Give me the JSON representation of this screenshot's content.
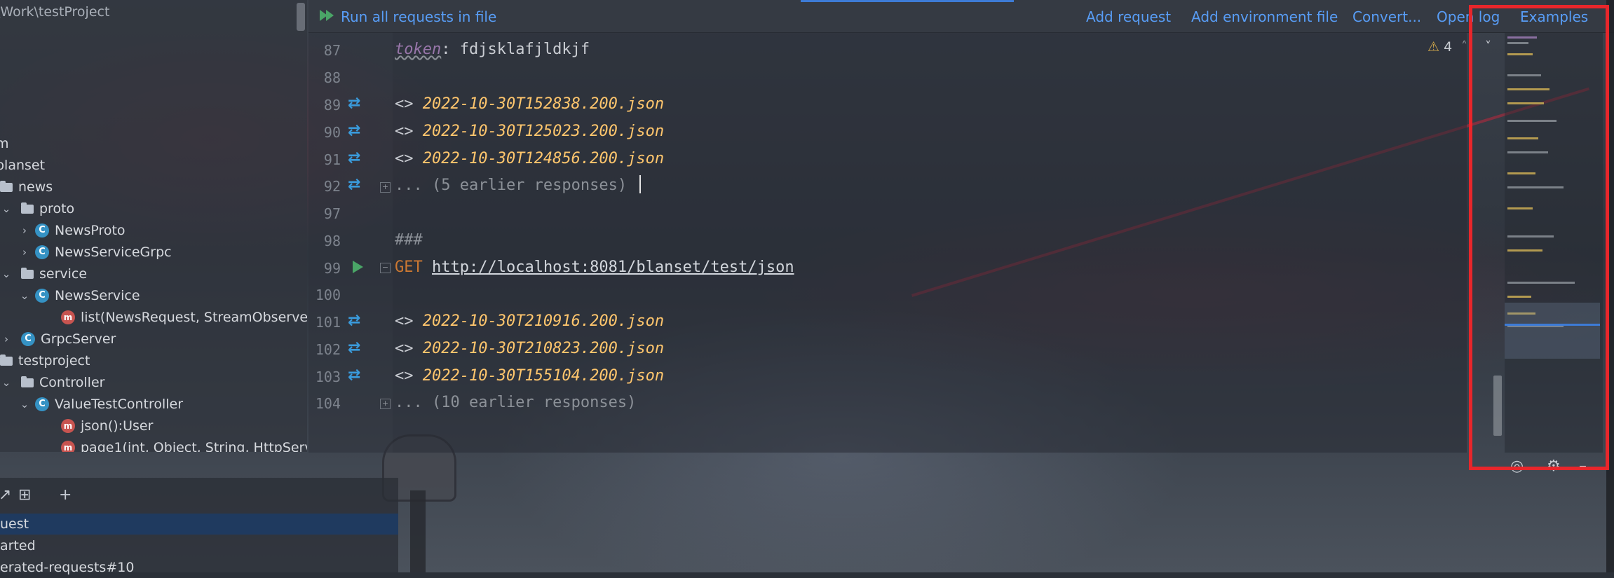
{
  "tree": {
    "title": "\\Work\\testProject",
    "rows": [
      {
        "label": "m"
      },
      {
        "label": "blanset"
      },
      {
        "label": "news"
      },
      {
        "label": "proto"
      },
      {
        "label": "NewsProto"
      },
      {
        "label": "NewsServiceGrpc"
      },
      {
        "label": "service"
      },
      {
        "label": "NewsService"
      },
      {
        "label": "list(NewsRequest, StreamObserver"
      },
      {
        "label": "GrpcServer"
      },
      {
        "label": "testproject"
      },
      {
        "label": "Controller"
      },
      {
        "label": "ValueTestController"
      },
      {
        "label": "json():User"
      },
      {
        "label": "page1(int, Object, String, HttpServ"
      }
    ]
  },
  "bottom_panel": {
    "items": [
      "uest",
      "arted",
      "erated-requests#10"
    ]
  },
  "toolbar": {
    "run_all": "Run all requests in file",
    "add_request": "Add request",
    "add_env": "Add environment file",
    "convert": "Convert...",
    "open_log": "Open log",
    "examples": "Examples"
  },
  "editor": {
    "line_numbers": [
      "87",
      "88",
      "89",
      "90",
      "91",
      "92",
      "97",
      "98",
      "99",
      "100",
      "101",
      "102",
      "103",
      "104"
    ],
    "token_key": "token",
    "token_value": ": fdjsklafjldkjf",
    "prefix": "<> ",
    "files_a": [
      "2022-10-30T152838.200.json",
      "2022-10-30T125023.200.json",
      "2022-10-30T124856.200.json"
    ],
    "earlier_a": "... (5 earlier responses)",
    "separator": "###",
    "method": "GET",
    "url": "http://localhost:8081/blanset/test/json",
    "files_b": [
      "2022-10-30T210916.200.json",
      "2022-10-30T210823.200.json",
      "2022-10-30T155104.200.json"
    ],
    "earlier_b": "... (10 earlier responses)"
  },
  "warnings": {
    "count": "4"
  },
  "colors": {
    "accent": "#589df6",
    "highlight": "#e8262b",
    "file": "#ffc66d",
    "method": "#cc7832"
  }
}
